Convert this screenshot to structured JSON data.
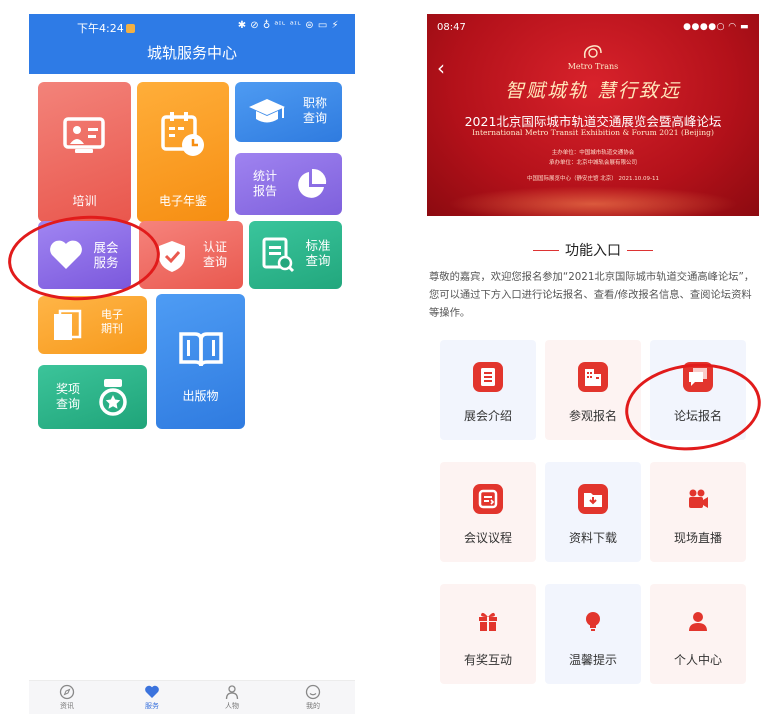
{
  "left": {
    "status_bar": {
      "time": "下午4:24",
      "indicators": "✱ ⊘ ♁ ᵃᶦᶫ ᵃᶦᶫ ⊜ ▭ ⚡"
    },
    "title": "城轨服务中心",
    "tiles": {
      "peixun": "培训",
      "nianjian": "电子年鉴",
      "zhicheng": [
        "职称",
        "查询"
      ],
      "tongji": [
        "统计",
        "报告"
      ],
      "zhanhui": [
        "展会",
        "服务"
      ],
      "renzheng": [
        "认证",
        "查询"
      ],
      "biaozhun": [
        "标准",
        "查询"
      ],
      "qikan": [
        "电子",
        "期刊"
      ],
      "chuban": "出版物",
      "jiangxiang": [
        "奖项",
        "查询"
      ]
    },
    "nav": [
      {
        "label": "资讯",
        "icon": "compass-icon"
      },
      {
        "label": "服务",
        "icon": "heart-icon"
      },
      {
        "label": "人物",
        "icon": "person-icon"
      },
      {
        "label": "我的",
        "icon": "smile-icon"
      }
    ]
  },
  "right": {
    "status_bar": {
      "time": "08:47",
      "indicators": "●●●●○ ◠ ▬"
    },
    "banner": {
      "logo_text": "Metro Trans",
      "slogan": "智赋城轨 慧行致远",
      "forum_cn": "2021北京国际城市轨道交通展览会暨高峰论坛",
      "forum_en": "International Metro Transit Exhibition & Forum 2021 (Beijing)",
      "organizer": "主办单位：中国城市轨道交通协会",
      "co_organizer": "承办单位：北京中城轨会展有限公司",
      "venue": "中国国际展览中心（静安庄馆 北京） 2021.10.09-11"
    },
    "section_title": "功能入口",
    "intro": "尊敬的嘉宾，欢迎您报名参加“2021北京国际城市轨道交通高峰论坛”，您可以通过下方入口进行论坛报名、查看/修改报名信息、查阅论坛资料等操作。",
    "features": [
      {
        "label": "展会介绍",
        "icon": "document-icon"
      },
      {
        "label": "参观报名",
        "icon": "building-icon"
      },
      {
        "label": "论坛报名",
        "icon": "chat-bubble-icon"
      },
      {
        "label": "会议议程",
        "icon": "agenda-icon"
      },
      {
        "label": "资料下载",
        "icon": "download-folder-icon"
      },
      {
        "label": "现场直播",
        "icon": "video-camera-icon"
      },
      {
        "label": "有奖互动",
        "icon": "gift-icon"
      },
      {
        "label": "温馨提示",
        "icon": "lightbulb-icon"
      },
      {
        "label": "个人中心",
        "icon": "user-icon"
      }
    ]
  },
  "colors": {
    "header_blue": "#2e7be6",
    "banner_red": "#b3111a",
    "feature_red": "#e2352d",
    "annotation_red": "#e11b1b"
  }
}
